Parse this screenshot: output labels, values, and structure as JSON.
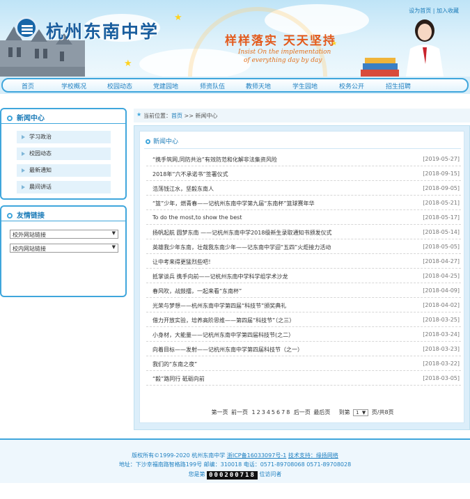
{
  "header": {
    "school_name": "杭州东南中学",
    "slogan_cn": "样样落实 天天坚持",
    "slogan_en_line1": "Insist On the implementation",
    "slogan_en_line2": "of everything day by day",
    "top_links": [
      "设为首页",
      "加入收藏"
    ],
    "separator": "|"
  },
  "nav": [
    "首页",
    "学校概况",
    "校园动态",
    "党建园地",
    "师资队伍",
    "教师天地",
    "学生园地",
    "校务公开",
    "招生招聘"
  ],
  "sidebar": {
    "news_title": "新闻中心",
    "news_items": [
      "学习政治",
      "校园动态",
      "最新通知",
      "晨间讲话"
    ],
    "links_title": "友情链接",
    "selects": [
      "校外网站链接",
      "校内网站链接"
    ]
  },
  "breadcrumb": {
    "prefix": "当前位置：",
    "home": "首页",
    "sep": ">>",
    "current": "新闻中心"
  },
  "main": {
    "title": "新闻中心",
    "news": [
      {
        "title": "“携手筑网,同防共治”有效防范和化解非法集资风险",
        "date": "[2019-05-27]"
      },
      {
        "title": "2018年“六不承诺书”签署仪式",
        "date": "[2018-09-15]"
      },
      {
        "title": "浩荡钱江水，坚毅东南人",
        "date": "[2018-09-05]"
      },
      {
        "title": "“篮”少年，燃青春——记杭州东南中学第九届“东南杯”篮球赛年华",
        "date": "[2018-05-21]"
      },
      {
        "title": "To do the most,to show the best",
        "date": "[2018-05-17]"
      },
      {
        "title": "扬帆起航 圆梦东南 ——记杭州东南中学2018级新生录取通知书颁发仪式",
        "date": "[2018-05-14]"
      },
      {
        "title": "英雄我少年东南，壮哉我东南少年——记东南中学迎“五四”火炬接力活动",
        "date": "[2018-05-05]"
      },
      {
        "title": "让中考来得更猛烈些吧！",
        "date": "[2018-04-27]"
      },
      {
        "title": "抵掌谈兵 携手向前——记杭州东南中学科学组学术沙龙",
        "date": "[2018-04-25]"
      },
      {
        "title": "春风吹，战鼓擂，一起来看“东南杯”",
        "date": "[2018-04-09]"
      },
      {
        "title": "光荣与梦想——杭州东南中学第四届“科技节”颁奖典礼",
        "date": "[2018-04-02]"
      },
      {
        "title": "借力开放实验，培养高阶思维——第四届“科技节”（之三）",
        "date": "[2018-03-25]"
      },
      {
        "title": "小身材，大能量——记杭州东南中学第四届科技节(之二）",
        "date": "[2018-03-24]"
      },
      {
        "title": "向着目标——发射——记杭州东南中学第四届科技节（之一）",
        "date": "[2018-03-23]"
      },
      {
        "title": "我们的“东南之夜”",
        "date": "[2018-03-22]"
      },
      {
        "title": "“毅”路同行 砥砺向前",
        "date": "[2018-03-05]"
      }
    ],
    "pager": {
      "first": "第一页",
      "prev": "前一页",
      "pages": [
        "1",
        "2",
        "3",
        "4",
        "5",
        "6",
        "7",
        "8"
      ],
      "next": "后一页",
      "last": "最后页",
      "goto": "到第",
      "page_value": "1",
      "total": "页/共8页"
    }
  },
  "footer": {
    "copyright": "版权所有©1999-2020 杭州东南中学",
    "icp": "浙ICP备16033097号-1",
    "tech_support": "技术支持：缘扬网络",
    "address": "地址：下沙幸福南路智格路199号 邮编：310018 电话：0571-89708068 0571-89708028",
    "visitor_prefix": "您是第",
    "visitor_count": "000200718",
    "visitor_suffix": "位访问者"
  },
  "colors": {
    "accent": "#3fa6dc",
    "link": "#1e7fc0",
    "slogan": "#e35a1c"
  }
}
